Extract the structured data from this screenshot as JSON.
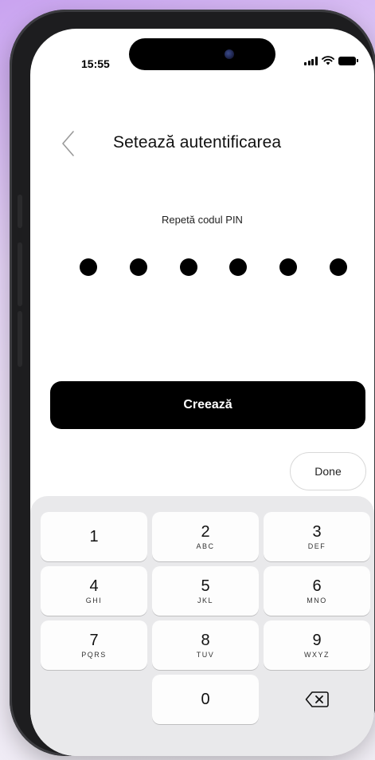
{
  "status_bar": {
    "time": "15:55"
  },
  "header": {
    "back_icon": "chevron-left-icon",
    "title": "Setează autentificarea"
  },
  "pin": {
    "label": "Repetă codul PIN",
    "length": 6,
    "filled": 6
  },
  "actions": {
    "create_label": "Creează",
    "done_label": "Done"
  },
  "keypad": {
    "keys": [
      {
        "digit": "1",
        "letters": ""
      },
      {
        "digit": "2",
        "letters": "ABC"
      },
      {
        "digit": "3",
        "letters": "DEF"
      },
      {
        "digit": "4",
        "letters": "GHI"
      },
      {
        "digit": "5",
        "letters": "JKL"
      },
      {
        "digit": "6",
        "letters": "MNO"
      },
      {
        "digit": "7",
        "letters": "PQRS"
      },
      {
        "digit": "8",
        "letters": "TUV"
      },
      {
        "digit": "9",
        "letters": "WXYZ"
      },
      {
        "digit": "0",
        "letters": ""
      }
    ],
    "backspace_icon": "backspace-icon"
  },
  "colors": {
    "primary_button": "#000000",
    "keyboard_bg": "#e9e9eb",
    "background_accent": "#c9a3f0"
  }
}
